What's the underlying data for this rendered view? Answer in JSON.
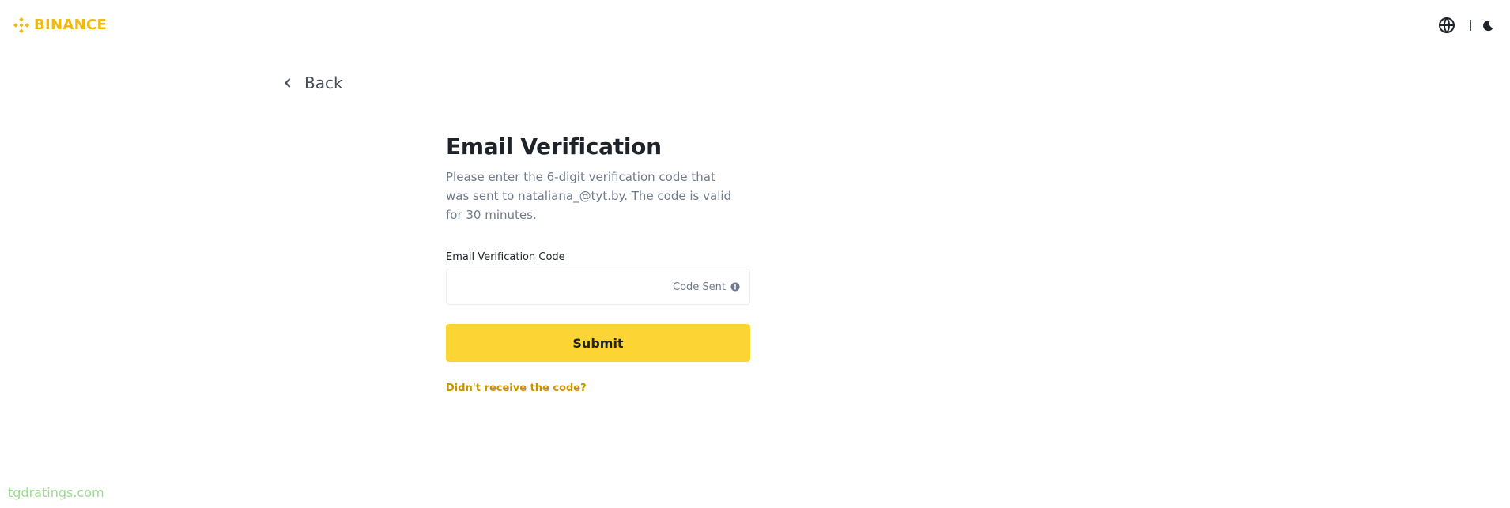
{
  "header": {
    "brand": "BINANCE",
    "logo_icon": "binance-logo-icon",
    "language_icon": "globe-icon",
    "theme_icon": "moon-icon"
  },
  "nav": {
    "back_label": "Back",
    "back_icon": "chevron-left-icon"
  },
  "form": {
    "title": "Email Verification",
    "description": "Please enter the 6-digit verification code that was sent to nataliana_@tyt.by. The code is valid for 30 minutes.",
    "field_label": "Email Verification Code",
    "input_value": "",
    "code_status": "Code Sent",
    "status_icon": "info-icon",
    "submit_label": "Submit",
    "resend_link": "Didn't receive the code?"
  },
  "watermark": "tgdratings.com",
  "colors": {
    "brand": "#F0B90B",
    "button": "#FCD535",
    "link": "#C99400",
    "text_primary": "#1E2329",
    "text_secondary": "#707A8A"
  }
}
